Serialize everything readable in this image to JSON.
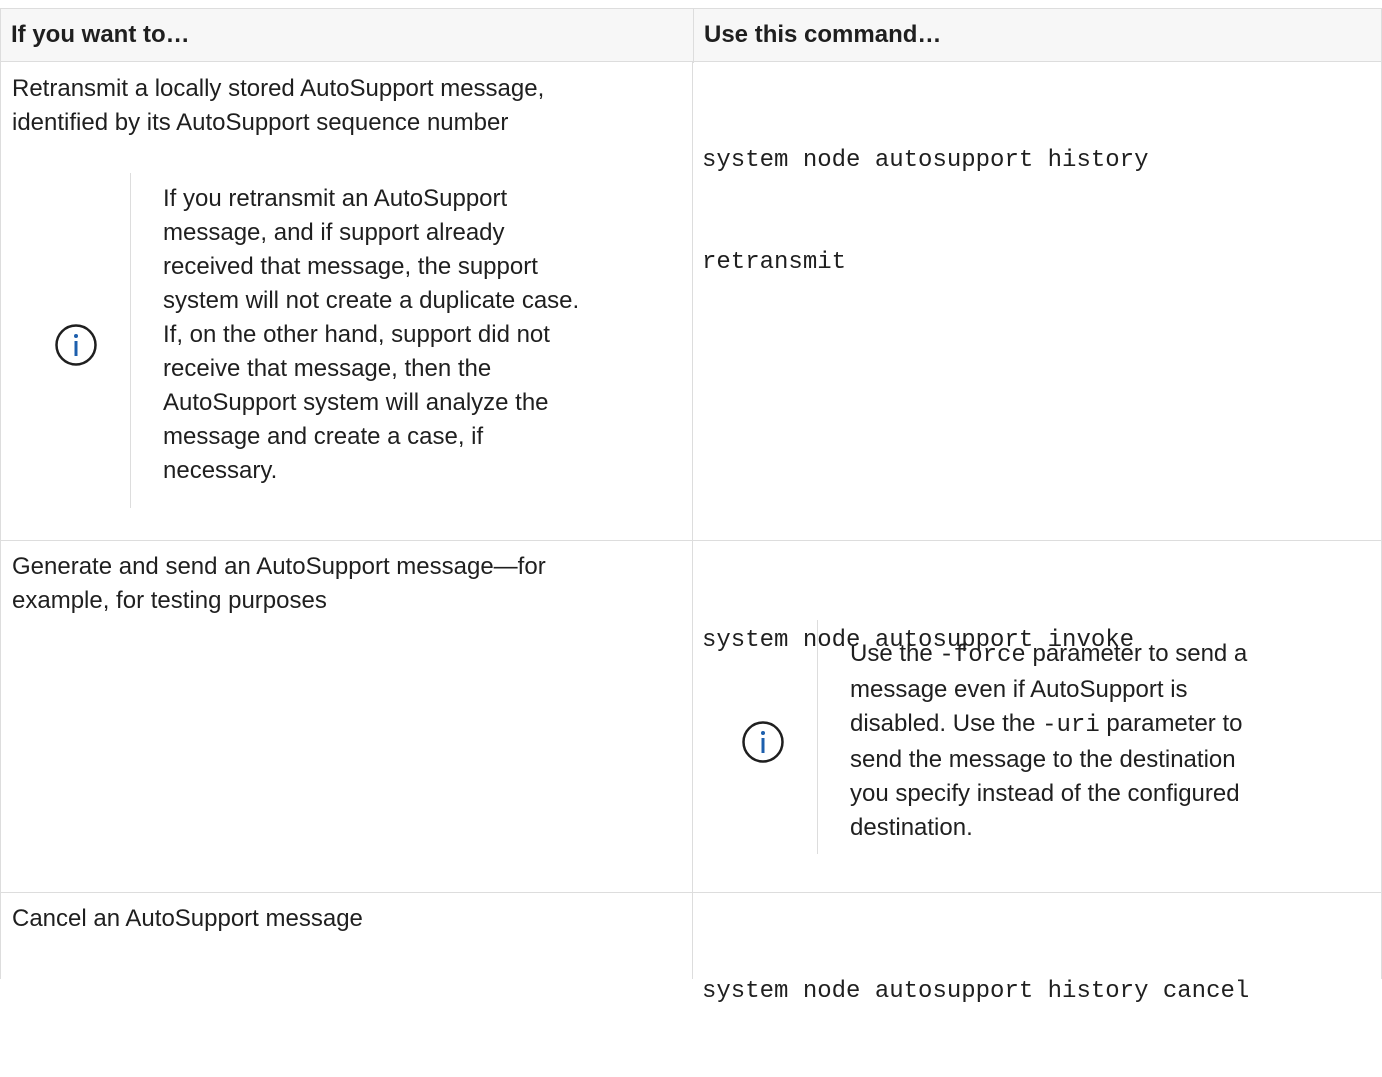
{
  "table": {
    "header": {
      "col1": "If you want to…",
      "col2": "Use this command…"
    },
    "rows": [
      {
        "task": "Retransmit a locally stored AutoSupport message, identified by its AutoSupport sequence number",
        "task_lines": [
          "Retransmit a locally stored AutoSupport message,",
          "identified by its AutoSupport sequence number"
        ],
        "command_lines": [
          "system node autosupport history",
          "retransmit"
        ],
        "note_lines": [
          "If you retransmit an AutoSupport",
          "message, and if support already",
          "received that message, the support",
          "system will not create a duplicate case.",
          "If, on the other hand, support did not",
          "receive that message, then the",
          "AutoSupport system will analyze the",
          "message and create a case, if",
          "necessary."
        ]
      },
      {
        "task_lines": [
          "Generate and send an AutoSupport message—for",
          "example, for testing purposes"
        ],
        "command_lines": [
          "system node autosupport invoke"
        ],
        "note": {
          "l1_pre": "Use the ",
          "l1_code": "-force",
          "l1_post": " parameter to send a",
          "l2": "message even if AutoSupport is",
          "l3_pre": "disabled. Use the ",
          "l3_code": "-uri",
          "l3_post": " parameter to",
          "l4": "send the message to the destination",
          "l5": "you specify instead of the configured",
          "l6": "destination."
        }
      },
      {
        "task_lines": [
          "Cancel an AutoSupport message"
        ],
        "command_lines": [
          "system node autosupport history cancel"
        ]
      }
    ]
  },
  "icons": {
    "info": "info-circle-icon",
    "color": "#1d5fad"
  }
}
